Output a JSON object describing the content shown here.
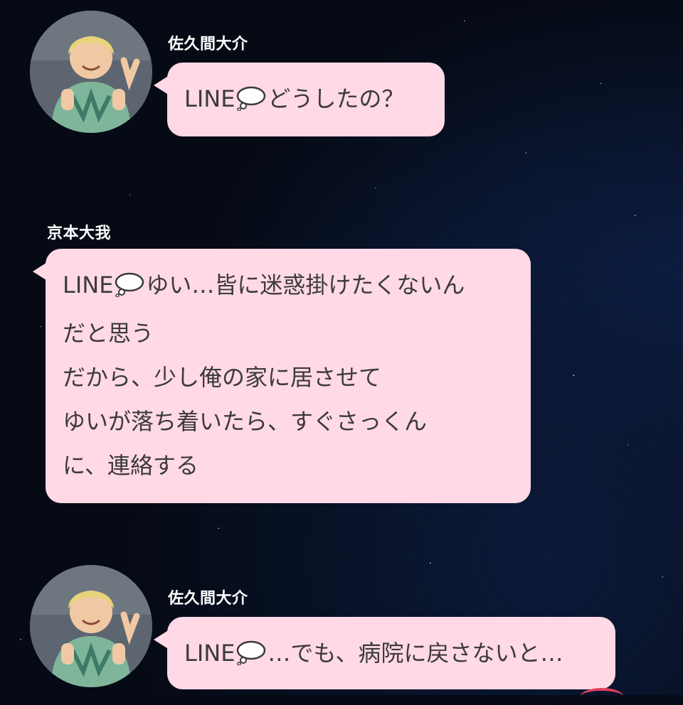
{
  "messages": [
    {
      "sender": "佐久間大介",
      "prefix": "LINE",
      "icon": "thought-bubble-icon",
      "lines": [
        "どうしたの？"
      ]
    },
    {
      "sender": "京本大我",
      "prefix": "LINE",
      "icon": "thought-bubble-icon",
      "lines": [
        "ゆい…皆に迷惑掛けたくないん",
        "だと思う",
        "だから、少し俺の家に居させて",
        "ゆいが落ち着いたら、すぐさっくん",
        "に、連絡する"
      ]
    },
    {
      "sender": "佐久間大介",
      "prefix": "LINE",
      "icon": "thought-bubble-icon",
      "lines": [
        "…でも、病院に戻さないと…"
      ]
    }
  ],
  "colors": {
    "bubble": "#ffd9e6",
    "text": "#3d3a3c",
    "background": "#050a14",
    "accent": "#e2405c"
  }
}
